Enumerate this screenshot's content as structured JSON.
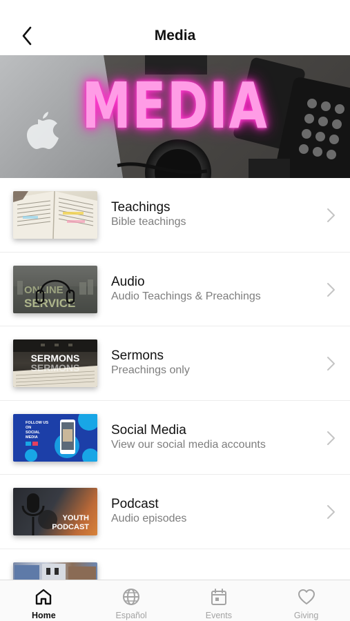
{
  "header": {
    "title": "Media"
  },
  "hero": {
    "title": "MEDIA",
    "accent": "#ff2ec8"
  },
  "items": [
    {
      "title": "Teachings",
      "subtitle": "Bible teachings",
      "thumb": "open-bible-thumbnail"
    },
    {
      "title": "Audio",
      "subtitle": "Audio Teachings & Preachings",
      "thumb": "headphones-online-service-thumbnail",
      "thumb_text": "ONLINE SERVICE"
    },
    {
      "title": "Sermons",
      "subtitle": "Preachings only",
      "thumb": "sermons-thumbnail",
      "thumb_text": "SERMONS"
    },
    {
      "title": "Social Media",
      "subtitle": "View our social media accounts",
      "thumb": "follow-us-thumbnail",
      "thumb_text": "FOLLOW US ON SOCIAL MEDIA"
    },
    {
      "title": "Podcast",
      "subtitle": "Audio episodes",
      "thumb": "youth-podcast-thumbnail",
      "thumb_text": "YOUTH PODCAST"
    },
    {
      "title": "",
      "subtitle": "",
      "thumb": "photo-collage-thumbnail"
    }
  ],
  "tabs": [
    {
      "label": "Home",
      "icon": "home-icon",
      "active": true
    },
    {
      "label": "Español",
      "icon": "globe-icon",
      "active": false
    },
    {
      "label": "Events",
      "icon": "calendar-icon",
      "active": false
    },
    {
      "label": "Giving",
      "icon": "heart-icon",
      "active": false
    }
  ],
  "colors": {
    "active_tab": "#111111",
    "inactive_tab": "#a3a3a3",
    "subtitle": "#7d7d7d"
  }
}
